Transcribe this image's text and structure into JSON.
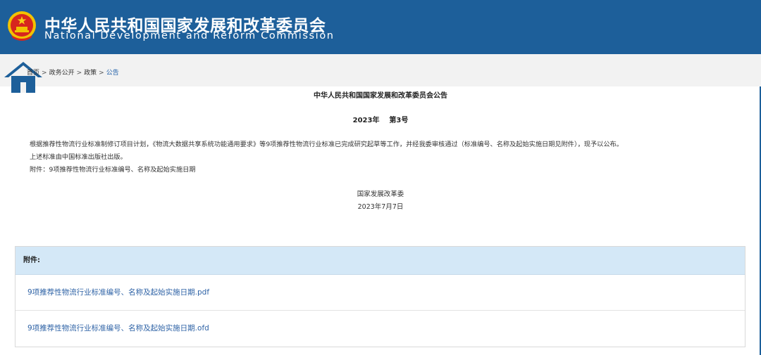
{
  "header": {
    "title_cn": "中华人民共和国国家发展和改革委员会",
    "title_en": "National Development and Reform Commission",
    "brand_color": "#1d5f9a"
  },
  "breadcrumb": {
    "items": [
      "首页",
      "政务公开",
      "政策",
      "公告"
    ],
    "separator": ">"
  },
  "document": {
    "title": "中华人民共和国国家发展和改革委员会公告",
    "number": "2023年    第3号",
    "paragraphs": [
      "根据推荐性物流行业标准制修订项目计划，《物流大数据共享系统功能通用要求》等9项推荐性物流行业标准已完成研究起草等工作，并经我委审核通过（标准编号、名称及起始实施日期见附件），现予以公布。",
      "上述标准由中国标准出版社出版。",
      "附件：9项推荐性物流行业标准编号、名称及起始实施日期"
    ],
    "signature": "国家发展改革委",
    "date": "2023年7月7日"
  },
  "attachments": {
    "heading": "附件:",
    "files": [
      "9项推荐性物流行业标准编号、名称及起始实施日期.pdf",
      "9项推荐性物流行业标准编号、名称及起始实施日期.ofd"
    ]
  }
}
